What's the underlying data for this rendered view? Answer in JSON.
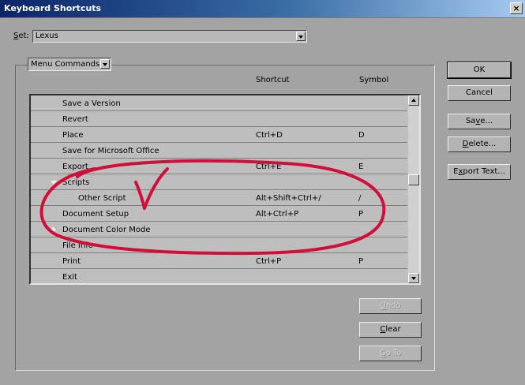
{
  "window": {
    "title": "Keyboard Shortcuts",
    "close_glyph": "×"
  },
  "set": {
    "label": "Set:",
    "value": "Lexus"
  },
  "commands_dropdown": {
    "value": "Menu Commands"
  },
  "columns": {
    "shortcut": "Shortcut",
    "symbol": "Symbol"
  },
  "rows": [
    {
      "name": "Save a Version",
      "shortcut": "",
      "symbol": ""
    },
    {
      "name": "Revert",
      "shortcut": "",
      "symbol": ""
    },
    {
      "name": "Place",
      "shortcut": "Ctrl+D",
      "symbol": "D"
    },
    {
      "name": "Save for Microsoft Office",
      "shortcut": "",
      "symbol": ""
    },
    {
      "name": "Export",
      "shortcut": "Ctrl+E",
      "symbol": "E"
    },
    {
      "name": "Scripts",
      "shortcut": "",
      "symbol": ""
    },
    {
      "name": "Other Script",
      "shortcut": "Alt+Shift+Ctrl+/",
      "symbol": "/"
    },
    {
      "name": "Document Setup",
      "shortcut": "Alt+Ctrl+P",
      "symbol": "P"
    },
    {
      "name": "Document Color Mode",
      "shortcut": "",
      "symbol": ""
    },
    {
      "name": "File Info",
      "shortcut": "",
      "symbol": ""
    },
    {
      "name": "Print",
      "shortcut": "Ctrl+P",
      "symbol": "P"
    },
    {
      "name": "Exit",
      "shortcut": "",
      "symbol": ""
    }
  ],
  "buttons": {
    "ok": "OK",
    "cancel": "Cancel",
    "save": "Save...",
    "delete": "Delete...",
    "export_text": "Export Text...",
    "undo": "Undo",
    "clear": "Clear",
    "goto": "Go To"
  },
  "annotation_color": "#d0103a"
}
